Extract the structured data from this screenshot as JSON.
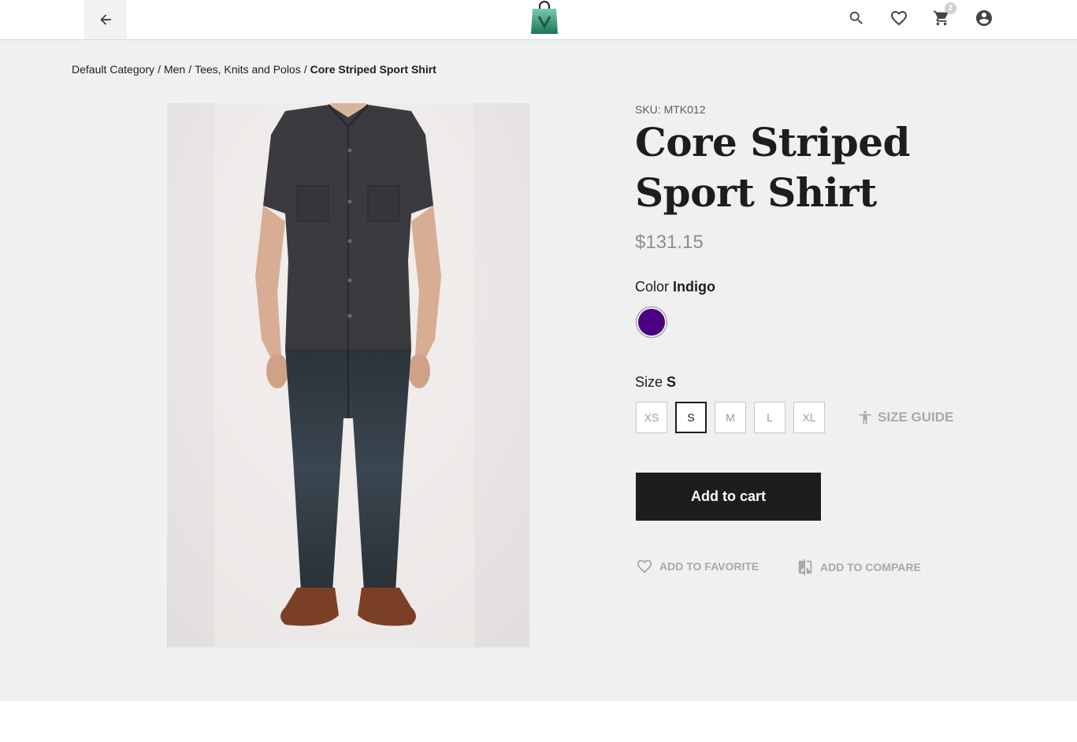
{
  "header": {
    "back_icon": "arrow-left-icon",
    "logo": "shopping-bag-logo",
    "icons": [
      "search-icon",
      "heart-icon",
      "cart-icon",
      "account-icon"
    ],
    "cart_count": "2"
  },
  "breadcrumb": {
    "items": [
      "Default Category",
      "Men",
      "Tees, Knits and Polos"
    ],
    "separator": "/",
    "current": "Core Striped Sport Shirt"
  },
  "product": {
    "sku_label": "SKU: MTK012",
    "title": "Core Striped Sport Shirt",
    "price": "$131.15",
    "color_label": "Color",
    "color_value": "Indigo",
    "color_hex": "#4b0082",
    "size_label": "Size",
    "size_value": "S",
    "sizes": [
      "XS",
      "S",
      "M",
      "L",
      "XL"
    ],
    "selected_size": "S",
    "size_guide_label": "SIZE GUIDE",
    "add_to_cart_label": "Add to cart",
    "add_to_favorite_label": "ADD TO FAVORITE",
    "add_to_compare_label": "ADD TO COMPARE"
  },
  "colors": {
    "page_bg": "#f0f0f0",
    "primary_button": "#1d1d1d",
    "muted_text": "#a8a8a8",
    "logo_green": "#2fb085"
  }
}
